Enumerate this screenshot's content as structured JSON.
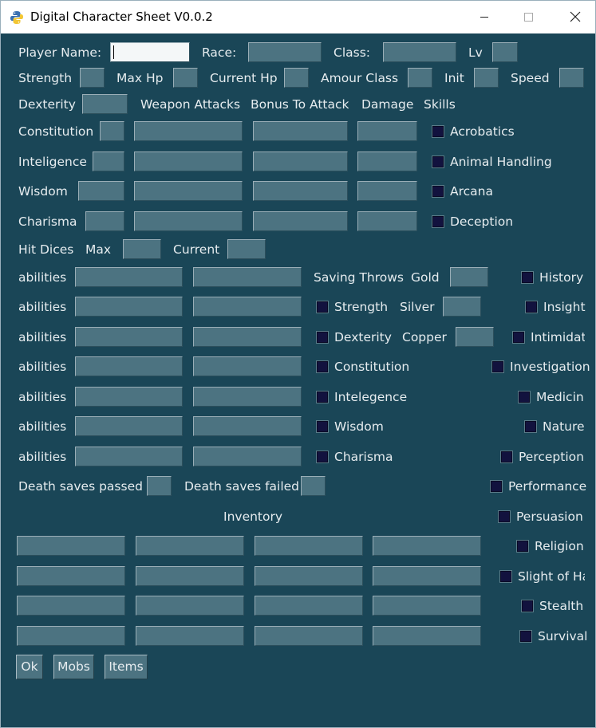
{
  "window": {
    "title": "Digital Character Sheet V0.0.2"
  },
  "header": {
    "player_name": "Player Name:",
    "race": "Race:",
    "class": "Class:",
    "level": "Lv"
  },
  "stats": {
    "strength": "Strength",
    "max_hp": "Max Hp",
    "current_hp": "Current Hp",
    "armour_class": "Amour Class",
    "init": "Init",
    "speed": "Speed",
    "dexterity": "Dexterity",
    "weapon_attacks": "Weapon Attacks",
    "bonus_to_attack": "Bonus To Attack",
    "damage": "Damage",
    "skills": "Skills",
    "constitution": "Constitution",
    "intelligence": "Inteligence",
    "wisdom": "Wisdom",
    "charisma": "Charisma"
  },
  "hit_dice": {
    "label": "Hit Dices",
    "max": "Max",
    "current": "Current"
  },
  "abilities": {
    "label": "abilities"
  },
  "saving_throws": {
    "title": "Saving Throws",
    "items": [
      "Strength",
      "Dexterity",
      "Constitution",
      "Intelegence",
      "Wisdom",
      "Charisma"
    ]
  },
  "currency": {
    "gold": "Gold",
    "silver": "Silver",
    "copper": "Copper"
  },
  "skills": [
    "Acrobatics",
    "Animal Handling",
    "Arcana",
    "Deception",
    "History",
    "Insight",
    "Intimidatio",
    "Investigation",
    "Medicin",
    "Nature",
    "Perception",
    "Performance",
    "Persuasion",
    "Religion",
    "Slight of Ha",
    "Stealth",
    "Survival"
  ],
  "death_saves": {
    "passed": "Death saves passed",
    "failed": "Death saves failed"
  },
  "inventory": {
    "title": "Inventory"
  },
  "buttons": {
    "ok": "Ok",
    "mobs": "Mobs",
    "items": "Items"
  },
  "colors": {
    "background": "#1a4657",
    "entry": "#4c7381",
    "text": "#e6ecef",
    "checkbox": "#12123e"
  }
}
